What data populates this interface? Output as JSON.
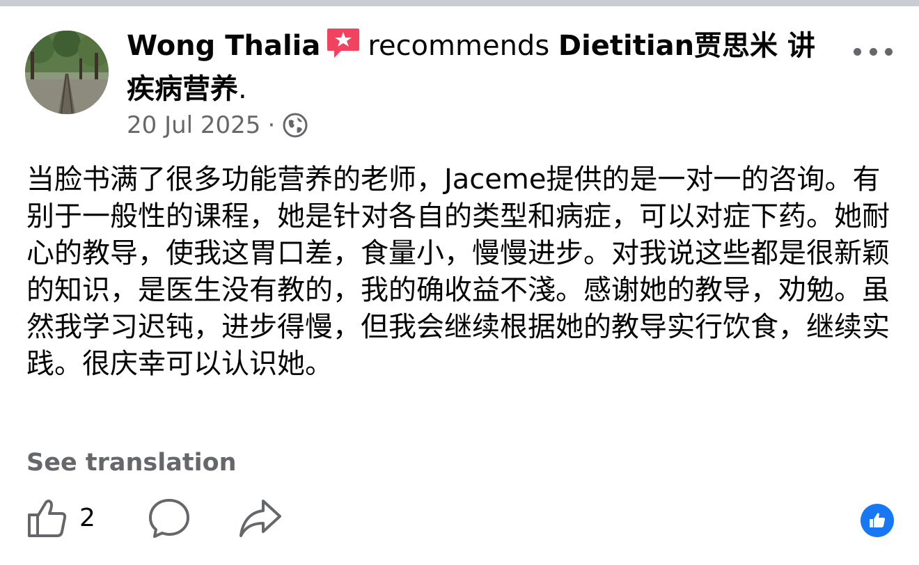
{
  "post": {
    "author": "Wong Thalia",
    "action": "recommends",
    "page_name": "Dietitian贾思米 讲疾病营养",
    "header_end": ".",
    "date": "20 Jul 2025",
    "separator": "·",
    "audience_icon": "globe-icon",
    "body": "当脸书满了很多功能营养的老师，Jaceme提供的是一对一的咨询。有别于一般性的课程，她是针对各自的类型和病症，可以对症下药。她耐心的教导，使我这胃口差，食量小，慢慢进步。对我说这些都是很新颖的知识，是医生没有教的，我的确收益不淺。感谢她的教导，劝勉。虽然我学习迟钝，进步得慢，但我会继续根据她的教导实行饮食，继续实践。很庆幸可以认识她。",
    "see_translation": "See translation"
  },
  "actions": {
    "like_count": "2",
    "like_icon": "thumbs-up-icon",
    "comment_icon": "comment-icon",
    "share_icon": "share-arrow-icon",
    "reaction_icon": "like-reaction-icon"
  },
  "colors": {
    "recommend_icon": "#f3425f",
    "secondary_text": "#65676b",
    "reaction_blue": "#1877f2"
  }
}
